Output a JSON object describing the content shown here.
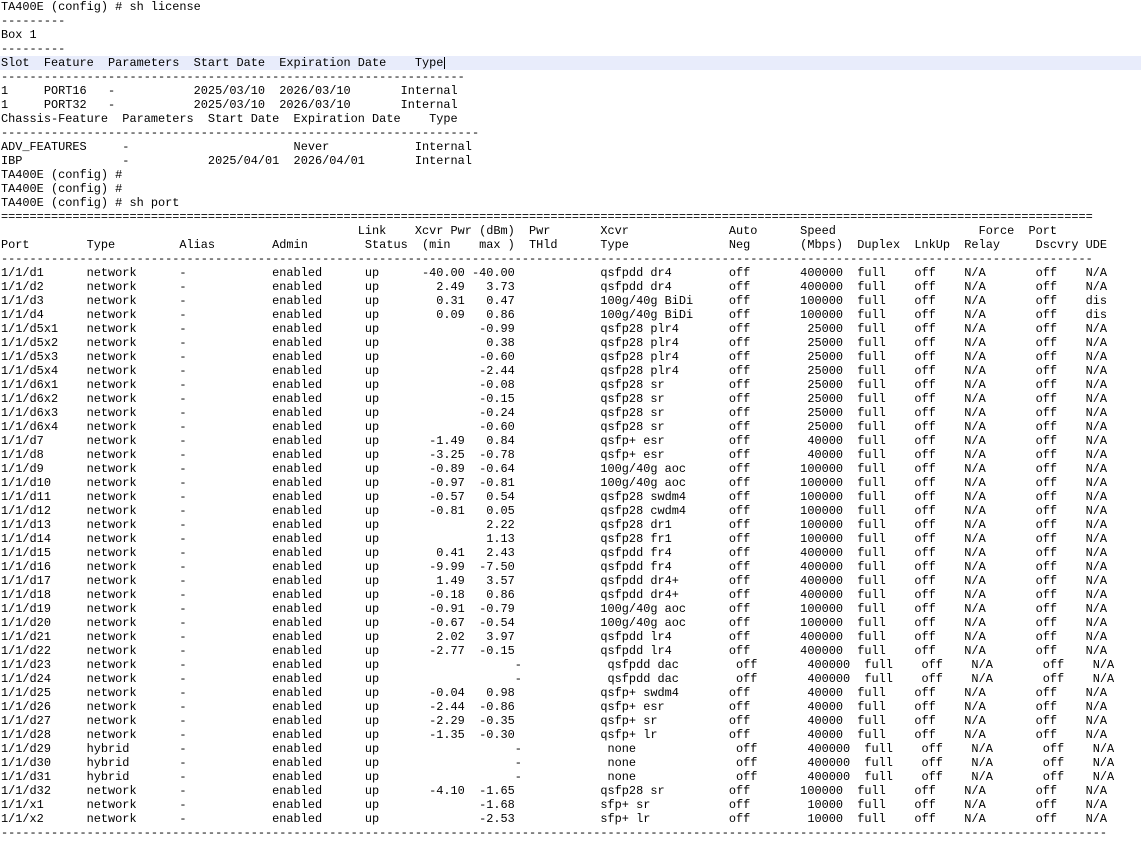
{
  "terminal": {
    "lines": [
      "TA400E (config) # sh license",
      "---------",
      "Box 1",
      "---------",
      "Slot  Feature  Parameters  Start Date  Expiration Date    Type",
      "-----------------------------------------------------------------",
      "1     PORT16   -           2025/03/10  2026/03/10       Internal",
      "1     PORT32   -           2025/03/10  2026/03/10       Internal",
      "Chassis-Feature  Parameters  Start Date  Expiration Date    Type",
      "-------------------------------------------------------------------",
      "ADV_FEATURES     -                       Never            Internal",
      "IBP              -           2025/04/01  2026/04/01       Internal",
      "TA400E (config) #",
      "TA400E (config) #",
      "TA400E (config) # sh port",
      "=========================================================================================================================================================",
      "                                                  Link    Xcvr Pwr (dBm)  Pwr       Xcvr              Auto      Speed                    Force  Port",
      "Port        Type         Alias        Admin        Status  (min    max )  THld      Type              Neg       (Mbps)  Duplex  LnkUp  Relay     Dscvry UDE",
      "---------------------------------------------------------------------------------------------------------------------------------------------------------",
      "1/1/d1      network      -            enabled      up      -40.00 -40.00            qsfpdd dr4        off       400000  full    off    N/A       off    N/A",
      "1/1/d2      network      -            enabled      up        2.49   3.73            qsfpdd dr4        off       400000  full    off    N/A       off    N/A",
      "1/1/d3      network      -            enabled      up        0.31   0.47            100g/40g BiDi     off       100000  full    off    N/A       off    dis",
      "1/1/d4      network      -            enabled      up        0.09   0.86            100g/40g BiDi     off       100000  full    off    N/A       off    dis",
      "1/1/d5x1    network      -            enabled      up              -0.99            qsfp28 plr4       off        25000  full    off    N/A       off    N/A",
      "1/1/d5x2    network      -            enabled      up               0.38            qsfp28 plr4       off        25000  full    off    N/A       off    N/A",
      "1/1/d5x3    network      -            enabled      up              -0.60            qsfp28 plr4       off        25000  full    off    N/A       off    N/A",
      "1/1/d5x4    network      -            enabled      up              -2.44            qsfp28 plr4       off        25000  full    off    N/A       off    N/A",
      "1/1/d6x1    network      -            enabled      up              -0.08            qsfp28 sr         off        25000  full    off    N/A       off    N/A",
      "1/1/d6x2    network      -            enabled      up              -0.15            qsfp28 sr         off        25000  full    off    N/A       off    N/A",
      "1/1/d6x3    network      -            enabled      up              -0.24            qsfp28 sr         off        25000  full    off    N/A       off    N/A",
      "1/1/d6x4    network      -            enabled      up              -0.60            qsfp28 sr         off        25000  full    off    N/A       off    N/A",
      "1/1/d7      network      -            enabled      up       -1.49   0.84            qsfp+ esr         off        40000  full    off    N/A       off    N/A",
      "1/1/d8      network      -            enabled      up       -3.25  -0.78            qsfp+ esr         off        40000  full    off    N/A       off    N/A",
      "1/1/d9      network      -            enabled      up       -0.89  -0.64            100g/40g aoc      off       100000  full    off    N/A       off    N/A",
      "1/1/d10     network      -            enabled      up       -0.97  -0.81            100g/40g aoc      off       100000  full    off    N/A       off    N/A",
      "1/1/d11     network      -            enabled      up       -0.57   0.54            qsfp28 swdm4      off       100000  full    off    N/A       off    N/A",
      "1/1/d12     network      -            enabled      up       -0.81   0.05            qsfp28 cwdm4      off       100000  full    off    N/A       off    N/A",
      "1/1/d13     network      -            enabled      up               2.22            qsfp28 dr1        off       100000  full    off    N/A       off    N/A",
      "1/1/d14     network      -            enabled      up               1.13            qsfp28 fr1        off       100000  full    off    N/A       off    N/A",
      "1/1/d15     network      -            enabled      up        0.41   2.43            qsfpdd fr4        off       400000  full    off    N/A       off    N/A",
      "1/1/d16     network      -            enabled      up       -9.99  -7.50            qsfpdd fr4        off       400000  full    off    N/A       off    N/A",
      "1/1/d17     network      -            enabled      up        1.49   3.57            qsfpdd dr4+       off       400000  full    off    N/A       off    N/A",
      "1/1/d18     network      -            enabled      up       -0.18   0.86            qsfpdd dr4+       off       400000  full    off    N/A       off    N/A",
      "1/1/d19     network      -            enabled      up       -0.91  -0.79            100g/40g aoc      off       100000  full    off    N/A       off    N/A",
      "1/1/d20     network      -            enabled      up       -0.67  -0.54            100g/40g aoc      off       100000  full    off    N/A       off    N/A",
      "1/1/d21     network      -            enabled      up        2.02   3.97            qsfpdd lr4        off       400000  full    off    N/A       off    N/A",
      "1/1/d22     network      -            enabled      up       -2.77  -0.15            qsfpdd lr4        off       400000  full    off    N/A       off    N/A",
      "1/1/d23     network      -            enabled      up                   -            qsfpdd dac        off       400000  full    off    N/A       off    N/A",
      "1/1/d24     network      -            enabled      up                   -            qsfpdd dac        off       400000  full    off    N/A       off    N/A",
      "1/1/d25     network      -            enabled      up       -0.04   0.98            qsfp+ swdm4       off        40000  full    off    N/A       off    N/A",
      "1/1/d26     network      -            enabled      up       -2.44  -0.86            qsfp+ esr         off        40000  full    off    N/A       off    N/A",
      "1/1/d27     network      -            enabled      up       -2.29  -0.35            qsfp+ sr          off        40000  full    off    N/A       off    N/A",
      "1/1/d28     network      -            enabled      up       -1.35  -0.30            qsfp+ lr          off        40000  full    off    N/A       off    N/A",
      "1/1/d29     hybrid       -            enabled      up                   -            none              off       400000  full    off    N/A       off    N/A",
      "1/1/d30     hybrid       -            enabled      up                   -            none              off       400000  full    off    N/A       off    N/A",
      "1/1/d31     hybrid       -            enabled      up                   -            none              off       400000  full    off    N/A       off    N/A",
      "1/1/d32     network      -            enabled      up       -4.10  -1.65            qsfp28 sr         off       100000  full    off    N/A       off    N/A",
      "1/1/x1      network      -            enabled      up              -1.68            sfp+ sr           off        10000  full    off    N/A       off    N/A",
      "1/1/x2      network      -            enabled      up              -2.53            sfp+ lr           off        10000  full    off    N/A       off    N/A",
      "-----------------------------------------------------------------------------------------------------------------------------------------------------------"
    ]
  }
}
